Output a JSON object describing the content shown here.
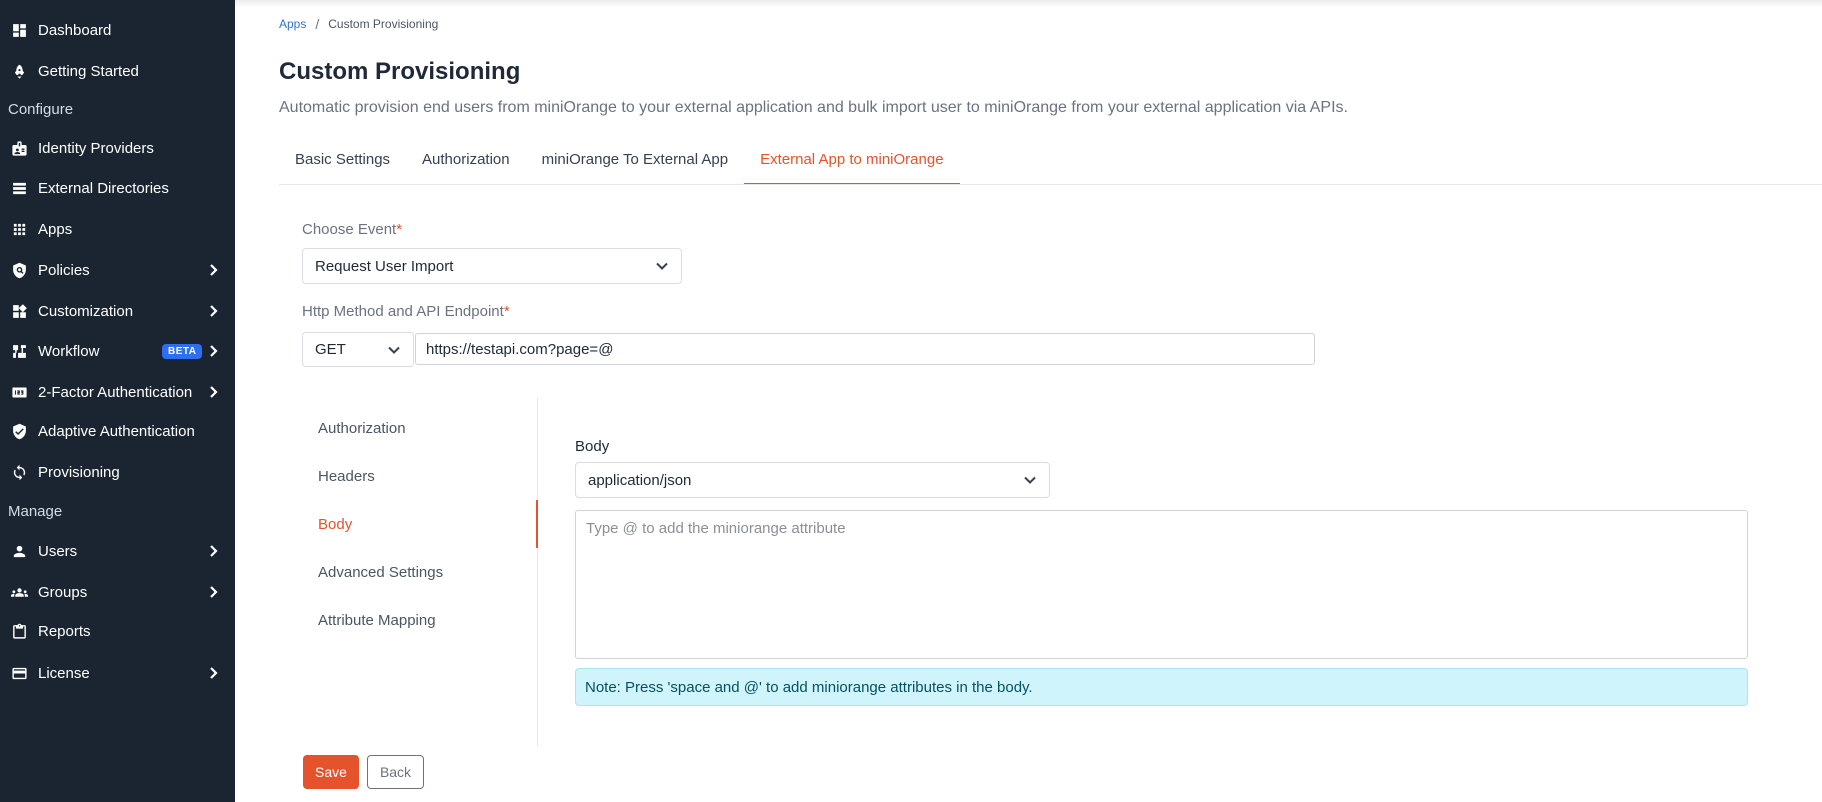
{
  "sidebar": {
    "items": [
      {
        "label": "Dashboard",
        "icon": "dashboard-icon"
      },
      {
        "label": "Getting Started",
        "icon": "rocket-icon"
      },
      {
        "label": "Identity Providers",
        "icon": "id-badge-icon"
      },
      {
        "label": "External Directories",
        "icon": "list-icon"
      },
      {
        "label": "Apps",
        "icon": "grid-icon"
      },
      {
        "label": "Policies",
        "icon": "shield-search-icon"
      },
      {
        "label": "Customization",
        "icon": "widgets-icon"
      },
      {
        "label": "Workflow",
        "icon": "workflow-icon",
        "badge": "BETA"
      },
      {
        "label": "2-Factor Authentication",
        "icon": "numeric-123-icon"
      },
      {
        "label": "Adaptive Authentication",
        "icon": "shield-check-icon"
      },
      {
        "label": "Provisioning",
        "icon": "sync-icon"
      },
      {
        "label": "Users",
        "icon": "user-icon"
      },
      {
        "label": "Groups",
        "icon": "groups-icon"
      },
      {
        "label": "Reports",
        "icon": "clipboard-icon"
      },
      {
        "label": "License",
        "icon": "card-icon"
      }
    ],
    "sections": {
      "configure": "Configure",
      "manage": "Manage"
    }
  },
  "breadcrumb": {
    "parent": "Apps",
    "separator": "/",
    "current": "Custom Provisioning"
  },
  "page": {
    "title": "Custom Provisioning",
    "description": "Automatic provision end users from miniOrange to your external application and bulk import user to miniOrange from your external application via APIs."
  },
  "tabs": [
    "Basic Settings",
    "Authorization",
    "miniOrange To External App",
    "External App to miniOrange"
  ],
  "form": {
    "choose_event_label": "Choose Event",
    "required_mark": "*",
    "choose_event_value": "Request User Import",
    "http_label": "Http Method and API Endpoint",
    "http_method": "GET",
    "endpoint": "https://testapi.com?page=@"
  },
  "subnav": [
    "Authorization",
    "Headers",
    "Body",
    "Advanced Settings",
    "Attribute Mapping"
  ],
  "body_section": {
    "label": "Body",
    "content_type": "application/json",
    "placeholder": "Type @ to add the miniorange attribute",
    "note": "Note: Press 'space and @' to add miniorange attributes in the body."
  },
  "buttons": {
    "save": "Save",
    "back": "Back"
  },
  "colors": {
    "sidebar_bg": "#1b2531",
    "accent": "#e5532d",
    "link": "#2f74d0",
    "badge": "#2d6ff0",
    "note_bg": "#cff4fc"
  }
}
